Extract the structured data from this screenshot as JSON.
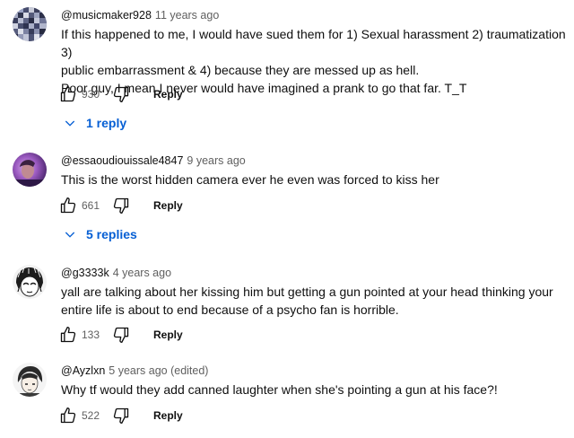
{
  "comments": [
    {
      "handle": "@musicmaker928",
      "time": "11 years ago",
      "avatar": "pixel-noise-avatar",
      "lines": [
        "If this happened to me, I would have sued them for 1) Sexual harassment 2) traumatization 3)",
        "public embarrassment & 4) because they are messed up as hell.",
        "Poor guy, I mean I never would have imagined a prank to go that far. T_T"
      ],
      "likes": "930",
      "reply_label": "Reply",
      "replies_label": "1 reply"
    },
    {
      "handle": "@essaoudiouissale4847",
      "time": "9 years ago",
      "avatar": "photo-avatar-purple",
      "lines": [
        "This is the worst hidden camera ever he even was forced to kiss her"
      ],
      "likes": "661",
      "reply_label": "Reply",
      "replies_label": "5 replies"
    },
    {
      "handle": "@g3333k",
      "time": "4 years ago",
      "avatar": "manga-sketch-avatar",
      "lines": [
        "yall are talking about her kissing him but getting a gun pointed at your head thinking your",
        "entire life is about to end because of a psycho fan is horrible."
      ],
      "likes": "133",
      "reply_label": "Reply"
    },
    {
      "handle": "@Ayzlxn",
      "time": "5 years ago (edited)",
      "avatar": "anime-boy-avatar",
      "lines": [
        "Why tf would they add canned laughter when she's pointing a gun at his face?!"
      ],
      "likes": "522",
      "reply_label": "Reply"
    }
  ],
  "colors": {
    "text": "#0f0f0f",
    "secondary": "#606060",
    "link": "#065fd4"
  },
  "icons": [
    "thumbs-up-icon",
    "thumbs-down-icon",
    "chevron-down-icon"
  ]
}
